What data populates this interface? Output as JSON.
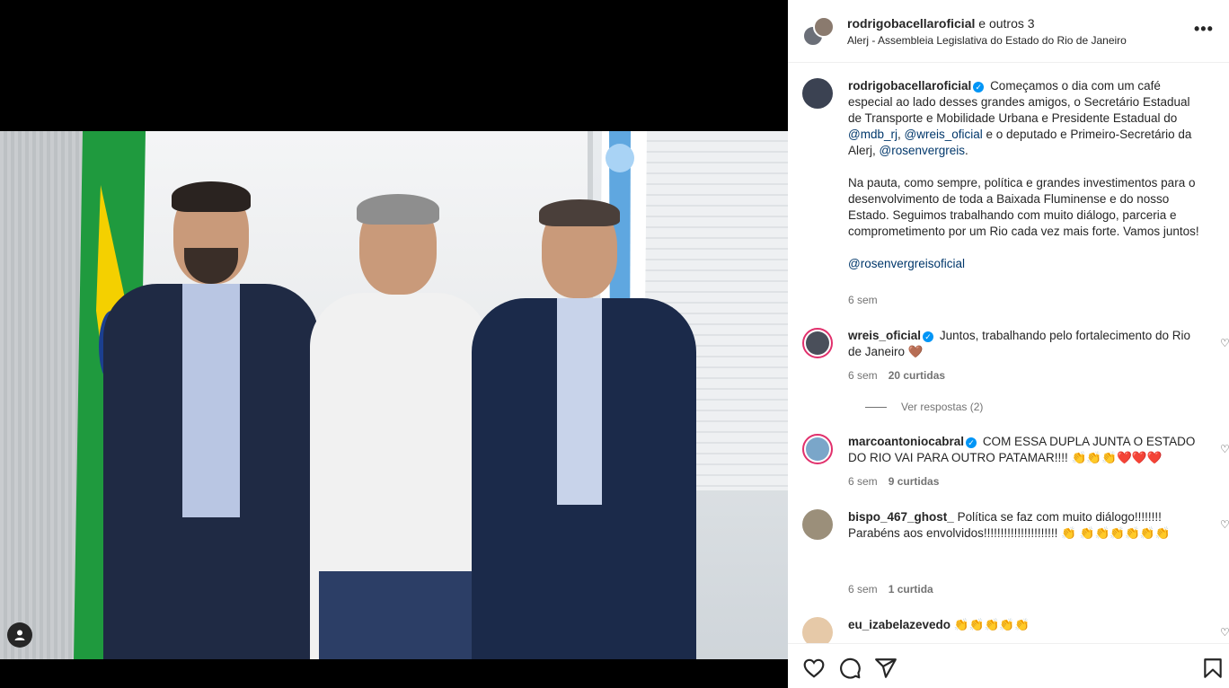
{
  "header": {
    "username": "rodrigobacellaroficial",
    "others": "e outros 3",
    "location": "Alerj - Assembleia Legislativa do Estado do Rio de Janeiro",
    "more_icon": "more-horizontal-icon"
  },
  "caption": {
    "username": "rodrigobacellaroficial",
    "text1": "Começamos o dia com um café especial ao lado desses grandes amigos, o Secretário Estadual de Transporte e Mobilidade Urbana e Presidente Estadual do",
    "mention1": "@mdb_rj",
    "sep1": ",",
    "mention2": "@wreis_oficial",
    "text2": "e o deputado e Primeiro-Secretário da Alerj,",
    "mention3": "@rosenvergreis",
    "text3": ".",
    "paragraph2": "Na pauta, como sempre, política e grandes investimentos para o desenvolvimento de toda a Baixada Fluminense e do nosso Estado. Seguimos trabalhando com muito diálogo, parceria e comprometimento por um Rio cada vez mais forte. Vamos juntos!",
    "mention4": "@rosenvergreisoficial",
    "time": "6 sem"
  },
  "comments": [
    {
      "username": "wreis_oficial",
      "text": "Juntos, trabalhando pelo fortalecimento do Rio de Janeiro 🤎",
      "time": "6 sem",
      "likes": "20 curtidas",
      "replies": "Ver respostas (2)"
    },
    {
      "username": "marcoantoniocabral",
      "text": "COM ESSA DUPLA JUNTA O ESTADO DO RIO VAI PARA OUTRO PATAMAR!!!! 👏👏👏❤️❤️❤️",
      "time": "6 sem",
      "likes": "9 curtidas"
    },
    {
      "username": "bispo_467_ghost_",
      "text": "Política se faz com muito diálogo!!!!!!!! Parabéns aos envolvidos!!!!!!!!!!!!!!!!!!!!!! 👏 👏👏👏👏👏👏",
      "time": "6 sem",
      "likes": "1 curtida"
    },
    {
      "username": "eu_izabelazevedo",
      "text": "👏👏👏👏👏"
    }
  ],
  "actions": {
    "like_icon": "heart-icon",
    "comment_icon": "comment-icon",
    "share_icon": "send-icon",
    "save_icon": "bookmark-icon"
  }
}
